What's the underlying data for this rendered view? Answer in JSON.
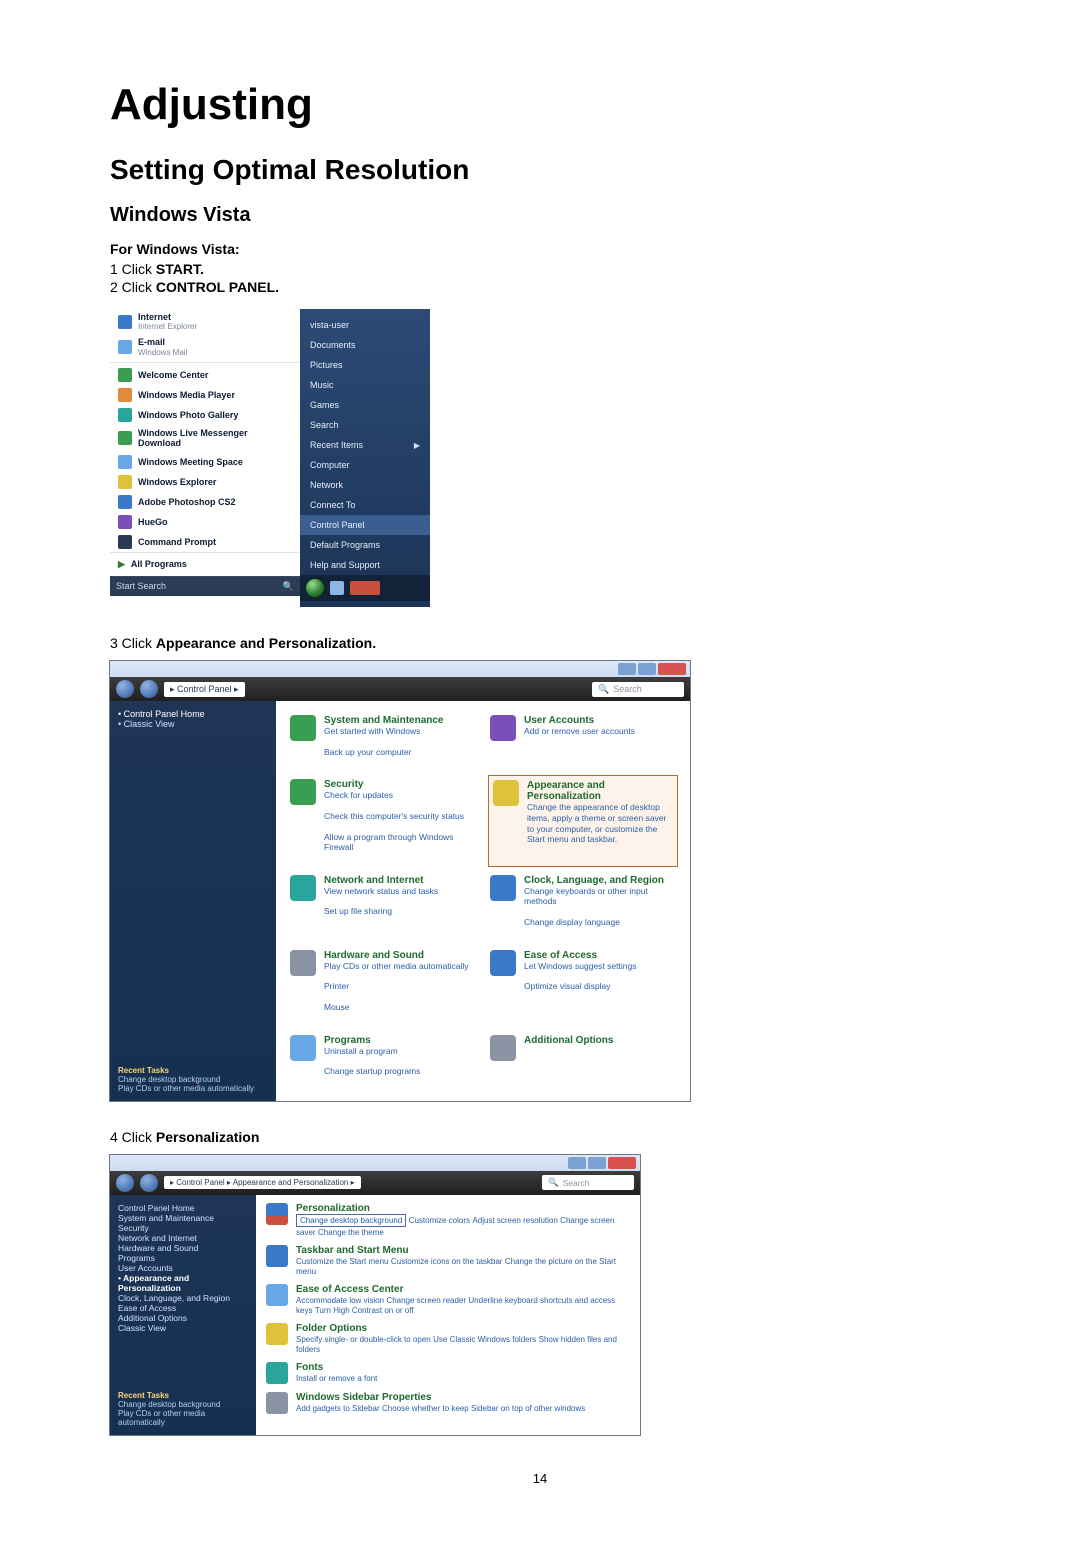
{
  "page": {
    "title": "Adjusting",
    "section": "Setting Optimal Resolution",
    "subsection": "Windows Vista",
    "intro": "For Windows Vista:",
    "page_number": "14"
  },
  "steps": {
    "s1": {
      "n": "1",
      "pre": " Click ",
      "kw": "START."
    },
    "s2": {
      "n": "2",
      "pre": " Click ",
      "kw": "CONTROL PANEL."
    },
    "s3": {
      "n": "3",
      "pre": " Click ",
      "kw": "Appearance and Personalization."
    },
    "s4": {
      "n": "4",
      "pre": " Click ",
      "kw": "Personalization"
    }
  },
  "start_menu": {
    "left": [
      {
        "title": "Internet",
        "sub": "Internet Explorer"
      },
      {
        "title": "E-mail",
        "sub": "Windows Mail"
      },
      {
        "title": "Welcome Center",
        "sub": ""
      },
      {
        "title": "Windows Media Player",
        "sub": ""
      },
      {
        "title": "Windows Photo Gallery",
        "sub": ""
      },
      {
        "title": "Windows Live Messenger Download",
        "sub": ""
      },
      {
        "title": "Windows Meeting Space",
        "sub": ""
      },
      {
        "title": "Windows Explorer",
        "sub": ""
      },
      {
        "title": "Adobe Photoshop CS2",
        "sub": ""
      },
      {
        "title": "HueGo",
        "sub": ""
      },
      {
        "title": "Command Prompt",
        "sub": ""
      }
    ],
    "all_programs": "All Programs",
    "search_placeholder": "Start Search",
    "right": [
      "vista-user",
      "Documents",
      "Pictures",
      "Music",
      "Games",
      "Search",
      "Recent Items",
      "Computer",
      "Network",
      "Connect To",
      "Control Panel",
      "Default Programs",
      "Help and Support"
    ],
    "right_highlight_index": 10
  },
  "control_panel": {
    "breadcrumb": "▸ Control Panel ▸",
    "search_placeholder": "Search",
    "sidebar": {
      "items": [
        "Control Panel Home",
        "Classic View"
      ],
      "recent_title": "Recent Tasks",
      "recent": [
        "Change desktop background",
        "Play CDs or other media automatically"
      ]
    },
    "categories_left": [
      {
        "title": "System and Maintenance",
        "links": [
          "Get started with Windows",
          "Back up your computer"
        ]
      },
      {
        "title": "Security",
        "links": [
          "Check for updates",
          "Check this computer's security status",
          "Allow a program through Windows Firewall"
        ]
      },
      {
        "title": "Network and Internet",
        "links": [
          "View network status and tasks",
          "Set up file sharing"
        ]
      },
      {
        "title": "Hardware and Sound",
        "links": [
          "Play CDs or other media automatically",
          "Printer",
          "Mouse"
        ]
      },
      {
        "title": "Programs",
        "links": [
          "Uninstall a program",
          "Change startup programs"
        ]
      }
    ],
    "categories_right": [
      {
        "title": "User Accounts",
        "links": [
          "Add or remove user accounts"
        ]
      },
      {
        "title": "Appearance and Personalization",
        "links": [
          "Change the appearance of desktop items, apply a theme or screen saver to your computer, or customize the Start menu and taskbar."
        ],
        "boxed": true
      },
      {
        "title": "Clock, Language, and Region",
        "links": [
          "Change keyboards or other input methods",
          "Change display language"
        ]
      },
      {
        "title": "Ease of Access",
        "links": [
          "Let Windows suggest settings",
          "Optimize visual display"
        ]
      },
      {
        "title": "Additional Options",
        "links": []
      }
    ]
  },
  "appearance_panel": {
    "breadcrumb": "▸ Control Panel ▸ Appearance and Personalization ▸",
    "search_placeholder": "Search",
    "sidebar": {
      "items": [
        "Control Panel Home",
        "System and Maintenance",
        "Security",
        "Network and Internet",
        "Hardware and Sound",
        "Programs",
        "User Accounts",
        "Appearance and Personalization",
        "Clock, Language, and Region",
        "Ease of Access",
        "Additional Options",
        "Classic View"
      ],
      "current_index": 7,
      "recent_title": "Recent Tasks",
      "recent": [
        "Change desktop background",
        "Play CDs or other media automatically"
      ]
    },
    "categories": [
      {
        "title": "Personalization",
        "boxed_link": "Change desktop background",
        "links": [
          "Customize colors",
          "Adjust screen resolution",
          "Change screen saver",
          "Change the theme"
        ]
      },
      {
        "title": "Taskbar and Start Menu",
        "links": [
          "Customize the Start menu",
          "Customize icons on the taskbar",
          "Change the picture on the Start menu"
        ]
      },
      {
        "title": "Ease of Access Center",
        "links": [
          "Accommodate low vision",
          "Change screen reader",
          "Underline keyboard shortcuts and access keys",
          "Turn High Contrast on or off"
        ]
      },
      {
        "title": "Folder Options",
        "links": [
          "Specify single- or double-click to open",
          "Use Classic Windows folders",
          "Show hidden files and folders"
        ]
      },
      {
        "title": "Fonts",
        "links": [
          "Install or remove a font"
        ]
      },
      {
        "title": "Windows Sidebar Properties",
        "links": [
          "Add gadgets to Sidebar",
          "Choose whether to keep Sidebar on top of other windows"
        ]
      }
    ]
  }
}
